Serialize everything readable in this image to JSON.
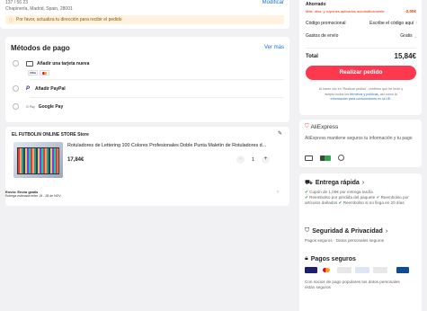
{
  "address": {
    "line1": "137 / 56 23",
    "line2": "Chapinería, Madrid, Spain, 28001",
    "modify_label": "Modificar",
    "warning": "Por favor, actualiza tu dirección para recibir el pedido"
  },
  "payment": {
    "title": "Métodos de pago",
    "see_more": "Ver más",
    "options": [
      {
        "label": "Añadir una tarjeta nueva"
      },
      {
        "label": "Añadir PayPal"
      },
      {
        "label": "Google Pay"
      }
    ],
    "gpay_prefix": "G Pay"
  },
  "store": {
    "name": "EL FUTBOLIN ONLINE STORE Store",
    "product_title": "Rotuladores de Lettering 100 Colores Profesionales Doble Punta Maletín de Rotuladores d...",
    "price": "17,84€",
    "quantity": "1",
    "minus": "−",
    "plus": "+",
    "shipping_title": "Envío: Envío gratis",
    "shipping_date": "Entrega estimada entre 19 - 28 de NOV"
  },
  "summary": {
    "saved_label": "Ahorrado",
    "saved_note": "Más. dtos. y cupones aplicados automáticamente",
    "saved_value": "-2,00€",
    "promo_label": "Código promocional",
    "promo_value": "Escribe el código aquí",
    "shipping_label": "Gastos de envío",
    "shipping_value": "Gratis",
    "total_label": "Total",
    "total_value": "15,84€",
    "cta": "Realizar pedido",
    "legal_1": "Al hacer clic en 'Realizar pedido', confirmo que he leído y",
    "legal_2a": "acepto todos los ",
    "legal_2b": "términos y políticas",
    "legal_2c": ", así como la",
    "legal_3": "información para consumidores en la UE."
  },
  "trust": {
    "brand": "AliExpress",
    "text": "AliExpress mantiene seguros tu información y tu pago"
  },
  "delivery": {
    "title": "Entrega rápida",
    "b1": "Cupón de 1,00€ por entrega tardía",
    "b2": "Reembolso por pérdida del paquete",
    "b3": "Reembolso por artículos dañados",
    "b4": "Reembolso si no llega en 20 días"
  },
  "security": {
    "title": "Seguridad & Privacidad",
    "text": "Pagos seguros · Datos personales seguros"
  },
  "secure_pay": {
    "title": "Pagos seguros",
    "text": "Con socios de pago populares tus datos personales están seguros"
  },
  "colors": {
    "accent": "#fd384f",
    "link": "#1a6fd6",
    "warning_bg": "#fff3e0",
    "green": "#1a9c3f"
  }
}
